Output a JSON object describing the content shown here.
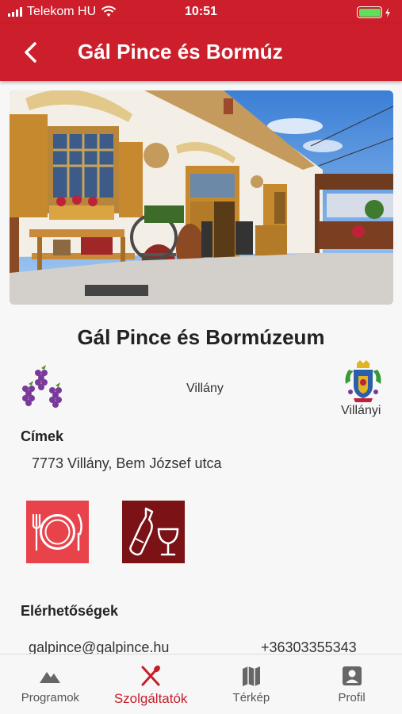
{
  "status": {
    "carrier": "Telekom HU",
    "time": "10:51",
    "battery_level": 1.0
  },
  "header": {
    "title": "Gál Pince és Bormúz"
  },
  "hero": {
    "icon": "winery-photo"
  },
  "venue": {
    "name": "Gál Pince és Bormúzeum",
    "city": "Villány",
    "region": "Villányi",
    "addresses_label": "Címek",
    "address": "7773 Villány, Bem József utca",
    "contacts_label": "Elérhetőségek",
    "email": "galpince@galpince.hu",
    "phone": "+36303355343"
  },
  "services": [
    {
      "icon": "plate-cutlery-icon",
      "color": "#e8434b"
    },
    {
      "icon": "wine-bottle-glass-icon",
      "color": "#7a1216"
    }
  ],
  "tabs": [
    {
      "label": "Programok",
      "icon": "mountain-icon",
      "active": false
    },
    {
      "label": "Szolgáltatók",
      "icon": "fork-spoon-icon",
      "active": true
    },
    {
      "label": "Térkép",
      "icon": "map-icon",
      "active": false
    },
    {
      "label": "Profil",
      "icon": "profile-icon",
      "active": false
    }
  ],
  "colors": {
    "brand": "#cc1f2b",
    "active_tab": "#c41e2a"
  }
}
